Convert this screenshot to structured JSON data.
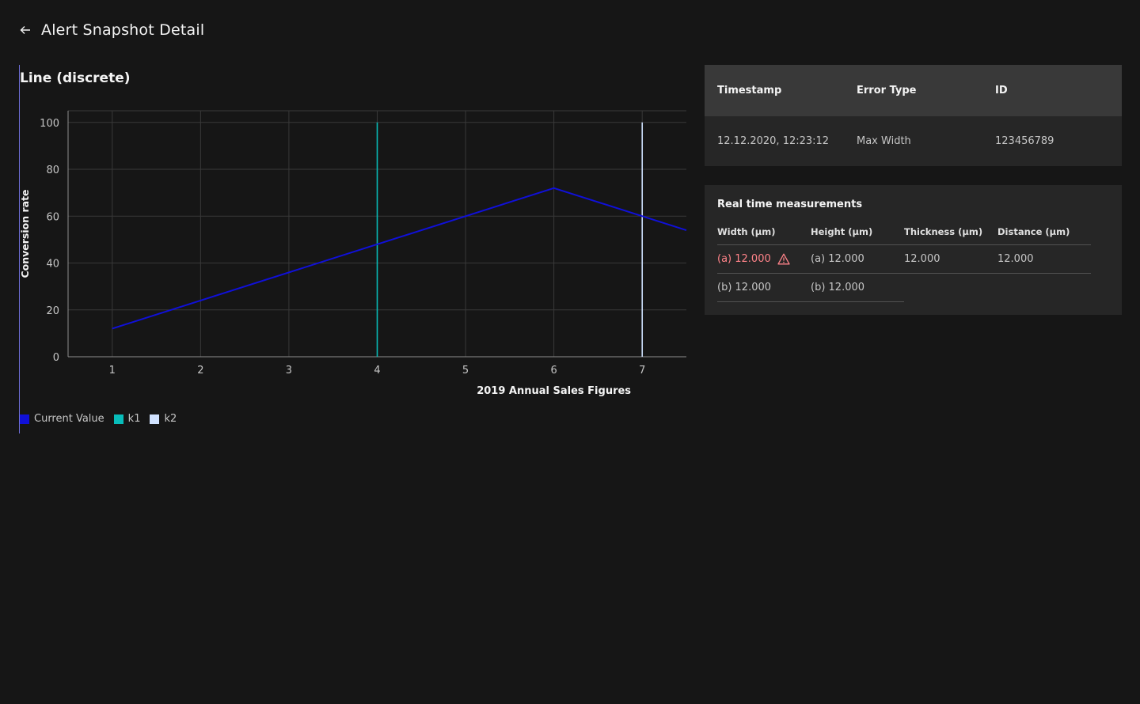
{
  "header": {
    "title": "Alert Snapshot Detail"
  },
  "chart_data": {
    "type": "line",
    "title": "Line (discrete)",
    "xlabel": "2019 Annual Sales Figures",
    "ylabel": "Conversion rate",
    "x_ticks": [
      1,
      2,
      3,
      4,
      5,
      6,
      7
    ],
    "xlim": [
      0.5,
      7.5
    ],
    "y_ticks": [
      0,
      20,
      40,
      60,
      80,
      100
    ],
    "ylim": [
      0,
      105
    ],
    "grid": true,
    "series": [
      {
        "name": "Current Value",
        "color": "#1010d8",
        "x": [
          1,
          6,
          7.5
        ],
        "y": [
          12,
          72,
          54
        ]
      }
    ],
    "thresholds": [
      {
        "name": "k1",
        "color": "#08bdba",
        "x": 4,
        "y_top": 100
      },
      {
        "name": "k2",
        "color": "#d0e2ff",
        "x": 7,
        "y_top": 100
      }
    ],
    "legend": [
      {
        "label": "Current Value",
        "color": "#1010d8"
      },
      {
        "label": "k1",
        "color": "#08bdba"
      },
      {
        "label": "k2",
        "color": "#d0e2ff"
      }
    ],
    "legend_position": "bottom-left"
  },
  "alert_table": {
    "headers": [
      "Timestamp",
      "Error Type",
      "ID"
    ],
    "row": [
      "12.12.2020, 12:23:12",
      "Max Width",
      "123456789"
    ]
  },
  "measurements": {
    "title": "Real time measurements",
    "headers": [
      "Width (μm)",
      "Height (μm)",
      "Thickness (μm)",
      "Distance (μm)"
    ],
    "row1": [
      "(a) 12.000",
      "(a) 12.000",
      "12.000",
      "12.000"
    ],
    "row2": [
      "(b) 12.000",
      "(b) 12.000"
    ],
    "alert_color": "#ff8389"
  }
}
